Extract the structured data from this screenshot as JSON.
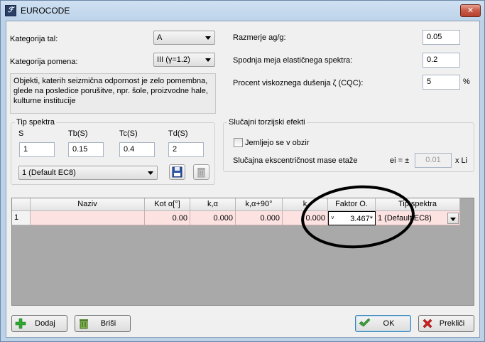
{
  "window": {
    "title": "EUROCODE",
    "close_label": "✕",
    "app_icon_glyph": "ℱ"
  },
  "left": {
    "soil_label": "Kategorija tal:",
    "soil_value": "A",
    "importance_label": "Kategorija pomena:",
    "importance_value": "III (γ=1.2)",
    "description": "Objekti, katerih seizmična odpornost je zelo pomembna, glede na posledice porušitve, npr. šole, proizvodne hale, kulturne institucije"
  },
  "right": {
    "ag_label": "Razmerje ag/g:",
    "ag_value": "0.05",
    "lower_bound_label": "Spodnja meja elastičnega spektra:",
    "lower_bound_value": "0.2",
    "damping_label": "Procent viskoznega dušenja ζ (CQC):",
    "damping_value": "5",
    "damping_unit": "%"
  },
  "spectrum_group": {
    "title": "Tip spektra",
    "columns": [
      "S",
      "Tb(S)",
      "Tc(S)",
      "Td(S)"
    ],
    "values": [
      "1",
      "0.15",
      "0.4",
      "2"
    ],
    "selected": "1 (Default EC8)"
  },
  "torsion_group": {
    "title": "Slučajni torzijski efekti",
    "checkbox_label": "Jemljejo se v obzir",
    "ecc_label": "Slučajna ekscentričnost mase etaže",
    "ecc_prefix": "ei = ±",
    "ecc_value": "0.01",
    "ecc_suffix": "x Li"
  },
  "grid": {
    "headers": [
      "",
      "Naziv",
      "Kot α[°]",
      "k,α",
      "k,α+90°",
      "k",
      "Faktor O.",
      "Tip spektra"
    ],
    "row": {
      "index": "1",
      "naziv": "",
      "kot": "0.00",
      "k_alpha": "0.000",
      "k_alpha90": "0.000",
      "k": "0.000",
      "faktor": "3.467*",
      "tip": "1 (Default EC8)"
    }
  },
  "buttons": {
    "add": "Dodaj",
    "delete": "Briši",
    "ok": "OK",
    "cancel": "Prekliči"
  },
  "colors": {
    "grid_row": "#fde2e2",
    "annotation": "#000000",
    "ok_check": "#3aa13a",
    "cancel_x": "#d22020",
    "add_plus": "#2fa82f"
  }
}
